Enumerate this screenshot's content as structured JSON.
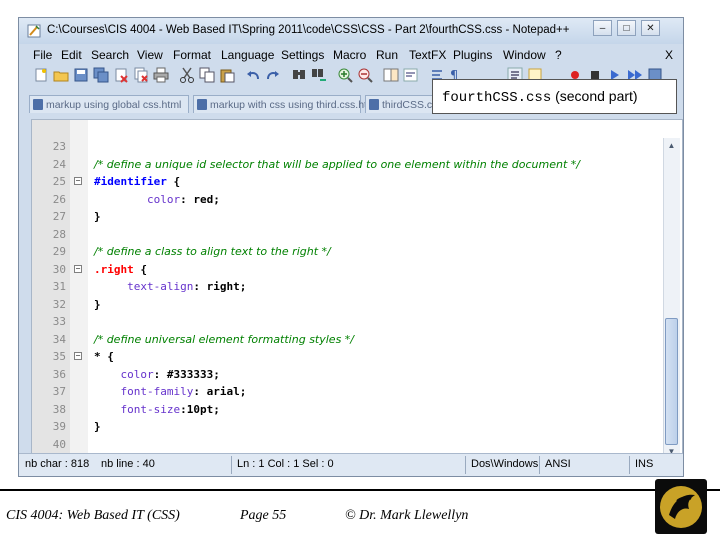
{
  "window": {
    "title": "C:\\Courses\\CIS 4004 - Web Based IT\\Spring 2011\\code\\CSS\\CSS - Part 2\\fourthCSS.css - Notepad++",
    "minimize_glyph": "–",
    "maximize_glyph": "□",
    "close_glyph": "✕"
  },
  "menu": {
    "items": [
      "File",
      "Edit",
      "Search",
      "View",
      "Format",
      "Language",
      "Settings",
      "Macro",
      "Run",
      "TextFX",
      "Plugins",
      "Window",
      "?"
    ],
    "close_label": "X"
  },
  "tabs": [
    {
      "label": "markup using global css.html"
    },
    {
      "label": "markup with css using third.css.html"
    },
    {
      "label": "thirdCSS.css"
    }
  ],
  "callout": {
    "filename": "fourthCSS.css",
    "note": "(second part)"
  },
  "editor": {
    "lines": [
      {
        "num": "23",
        "fold": "",
        "tokens": []
      },
      {
        "num": "24",
        "fold": "",
        "tokens": [
          {
            "t": "cm",
            "v": "/* define a unique id selector that will be applied to one element within the document */"
          }
        ]
      },
      {
        "num": "25",
        "fold": "−",
        "tokens": [
          {
            "t": "sel",
            "v": "#identifier"
          },
          {
            "t": "br",
            "v": " {"
          }
        ]
      },
      {
        "num": "26",
        "fold": "",
        "tokens": [
          {
            "t": "pad",
            "v": "        "
          },
          {
            "t": "prop",
            "v": "color"
          },
          {
            "t": "br",
            "v": ": "
          },
          {
            "t": "val",
            "v": "red"
          },
          {
            "t": "br",
            "v": ";"
          }
        ]
      },
      {
        "num": "27",
        "fold": "",
        "tokens": [
          {
            "t": "br",
            "v": "}"
          }
        ]
      },
      {
        "num": "28",
        "fold": "",
        "tokens": []
      },
      {
        "num": "29",
        "fold": "",
        "tokens": [
          {
            "t": "cm",
            "v": "/* define a class to align text to the right */"
          }
        ]
      },
      {
        "num": "30",
        "fold": "−",
        "tokens": [
          {
            "t": "cls",
            "v": ".right"
          },
          {
            "t": "br",
            "v": " {"
          }
        ]
      },
      {
        "num": "31",
        "fold": "",
        "tokens": [
          {
            "t": "pad",
            "v": "     "
          },
          {
            "t": "prop",
            "v": "text-align"
          },
          {
            "t": "br",
            "v": ": "
          },
          {
            "t": "val",
            "v": "right"
          },
          {
            "t": "br",
            "v": ";"
          }
        ]
      },
      {
        "num": "32",
        "fold": "",
        "tokens": [
          {
            "t": "br",
            "v": "}"
          }
        ]
      },
      {
        "num": "33",
        "fold": "",
        "tokens": []
      },
      {
        "num": "34",
        "fold": "",
        "tokens": [
          {
            "t": "cm",
            "v": "/* define universal element formatting styles */"
          }
        ]
      },
      {
        "num": "35",
        "fold": "−",
        "tokens": [
          {
            "t": "br",
            "v": "* {"
          }
        ]
      },
      {
        "num": "36",
        "fold": "",
        "tokens": [
          {
            "t": "pad",
            "v": "    "
          },
          {
            "t": "prop",
            "v": "color"
          },
          {
            "t": "br",
            "v": ": "
          },
          {
            "t": "val",
            "v": "#333333"
          },
          {
            "t": "br",
            "v": ";"
          }
        ]
      },
      {
        "num": "37",
        "fold": "",
        "tokens": [
          {
            "t": "pad",
            "v": "    "
          },
          {
            "t": "prop",
            "v": "font-family"
          },
          {
            "t": "br",
            "v": ": "
          },
          {
            "t": "val",
            "v": "arial"
          },
          {
            "t": "br",
            "v": ";"
          }
        ]
      },
      {
        "num": "38",
        "fold": "",
        "tokens": [
          {
            "t": "pad",
            "v": "    "
          },
          {
            "t": "prop",
            "v": "font-size"
          },
          {
            "t": "br",
            "v": ":"
          },
          {
            "t": "val",
            "v": "10pt"
          },
          {
            "t": "br",
            "v": ";"
          }
        ]
      },
      {
        "num": "39",
        "fold": "",
        "tokens": [
          {
            "t": "br",
            "v": "}"
          }
        ]
      },
      {
        "num": "40",
        "fold": "",
        "tokens": []
      }
    ]
  },
  "status": {
    "nb_char": "nb char : 818",
    "nb_line": "nb line : 40",
    "position": "Ln : 1    Col : 1    Sel : 0",
    "eol": "Dos\\Windows",
    "encoding": "ANSI",
    "mode": "INS"
  },
  "footer": {
    "course": "CIS 4004: Web Based IT (CSS)",
    "page": "Page 55",
    "author": "© Dr. Mark Llewellyn"
  },
  "colors": {
    "comment": "#008000",
    "id_selector": "#0000ff",
    "class_selector": "#ff0000",
    "property": "#6633cc"
  },
  "icons": {
    "toolbar": [
      "new-file-icon",
      "open-file-icon",
      "save-icon",
      "save-all-icon",
      "close-icon",
      "close-all-icon",
      "print-icon",
      "cut-icon",
      "copy-icon",
      "paste-icon",
      "undo-icon",
      "redo-icon",
      "find-icon",
      "replace-icon",
      "zoom-in-icon",
      "zoom-out-icon",
      "sync-scroll-icon",
      "wrap-icon",
      "show-all-chars-icon",
      "indent-guide-icon",
      "record-macro-icon",
      "stop-macro-icon",
      "play-macro-icon",
      "run-macro-multiple-icon",
      "save-macro-icon"
    ]
  }
}
